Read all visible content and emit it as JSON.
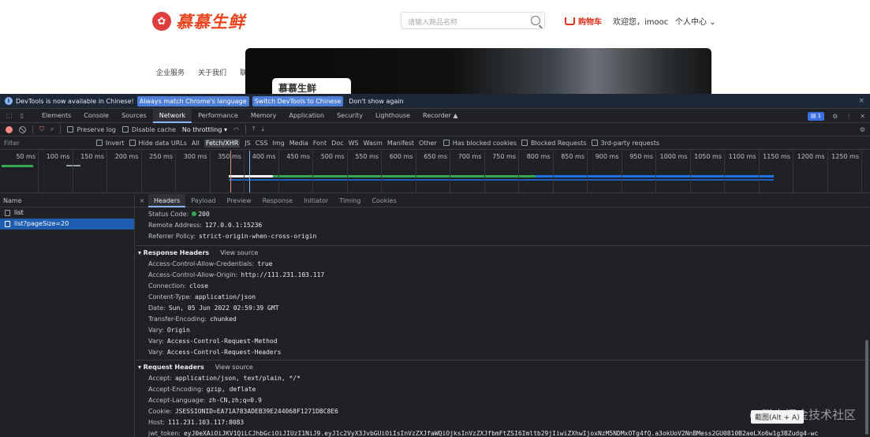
{
  "site": {
    "logo_text": "慕慕生鲜",
    "search_placeholder": "请输入商品名称",
    "cart_label": "购物车",
    "welcome": "欢迎您，imooc",
    "user_center": "个人中心",
    "nav": [
      "企业服务",
      "关于我们",
      "联"
    ],
    "banner_logo": "慕慕生鲜"
  },
  "devtools": {
    "infobar": {
      "message": "DevTools is now available in Chinese!",
      "btn1": "Always match Chrome's language",
      "btn2": "Switch DevTools to Chinese",
      "dont_show": "Don't show again",
      "close": "×"
    },
    "tabs": [
      "Elements",
      "Console",
      "Sources",
      "Network",
      "Performance",
      "Memory",
      "Application",
      "Security",
      "Lighthouse",
      "Recorder ▲"
    ],
    "active_tab": "Network",
    "issues_badge": "1",
    "toolbar": {
      "preserve_log": "Preserve log",
      "disable_cache": "Disable cache",
      "throttling": "No throttling ▾"
    },
    "filter": {
      "placeholder": "Filter",
      "invert": "Invert",
      "hide_data_urls": "Hide data URLs",
      "types": [
        "All",
        "Fetch/XHR",
        "JS",
        "CSS",
        "Img",
        "Media",
        "Font",
        "Doc",
        "WS",
        "Wasm",
        "Manifest",
        "Other"
      ],
      "active_type": "Fetch/XHR",
      "has_blocked": "Has blocked cookies",
      "blocked_requests": "Blocked Requests",
      "third_party": "3rd-party requests"
    },
    "timeline": [
      "50 ms",
      "100 ms",
      "150 ms",
      "200 ms",
      "250 ms",
      "300 ms",
      "350 ms",
      "400 ms",
      "450 ms",
      "500 ms",
      "550 ms",
      "600 ms",
      "650 ms",
      "700 ms",
      "750 ms",
      "800 ms",
      "850 ms",
      "900 ms",
      "950 ms",
      "1000 ms",
      "1050 ms",
      "1100 ms",
      "1150 ms",
      "1200 ms",
      "1250 ms"
    ],
    "requests": {
      "header": "Name",
      "items": [
        "list",
        "list?pageSize=20"
      ],
      "selected": 1
    },
    "detail_tabs": [
      "Headers",
      "Payload",
      "Preview",
      "Response",
      "Initiator",
      "Timing",
      "Cookies"
    ],
    "detail_active": "Headers",
    "general": [
      {
        "k": "Status Code:",
        "v": "200",
        "dot": true
      },
      {
        "k": "Remote Address:",
        "v": "127.0.0.1:15236"
      },
      {
        "k": "Referrer Policy:",
        "v": "strict-origin-when-cross-origin"
      }
    ],
    "response_headers": {
      "title": "Response Headers",
      "view_source": "View source",
      "items": [
        {
          "k": "Access-Control-Allow-Credentials:",
          "v": "true"
        },
        {
          "k": "Access-Control-Allow-Origin:",
          "v": "http://111.231.103.117"
        },
        {
          "k": "Connection:",
          "v": "close"
        },
        {
          "k": "Content-Type:",
          "v": "application/json"
        },
        {
          "k": "Date:",
          "v": "Sun, 05 Jun 2022 02:59:39 GMT"
        },
        {
          "k": "Transfer-Encoding:",
          "v": "chunked"
        },
        {
          "k": "Vary:",
          "v": "Origin"
        },
        {
          "k": "Vary:",
          "v": "Access-Control-Request-Method"
        },
        {
          "k": "Vary:",
          "v": "Access-Control-Request-Headers"
        }
      ]
    },
    "request_headers": {
      "title": "Request Headers",
      "view_source": "View source",
      "items": [
        {
          "k": "Accept:",
          "v": "application/json, text/plain, */*"
        },
        {
          "k": "Accept-Encoding:",
          "v": "gzip, deflate"
        },
        {
          "k": "Accept-Language:",
          "v": "zh-CN,zh;q=0.9"
        },
        {
          "k": "Cookie:",
          "v": "JSESSIONID=EA71A783ADEB39E244068F1271DBC8E6"
        },
        {
          "k": "Host:",
          "v": "111.231.103.117:8083"
        },
        {
          "k": "jwt_token:",
          "v": "eyJ0eXAiOiJKV1QiLCJhbGciOiJIUzI1NiJ9.eyJ1c2VyX3JvbGUiOiIsInVzZXJfaWQiOjksInVzZXJfbmFtZSI6Imltb29jIiwiZXhwIjoxNzM5NDMxOTg4fQ.a3okUoV2NnBMess2GU0810B2aeLXo6w1g3BZudg4-wc"
        }
      ]
    },
    "tooltip": "截图(Alt + A)",
    "watermark": "@稀土掘金技术社区"
  }
}
